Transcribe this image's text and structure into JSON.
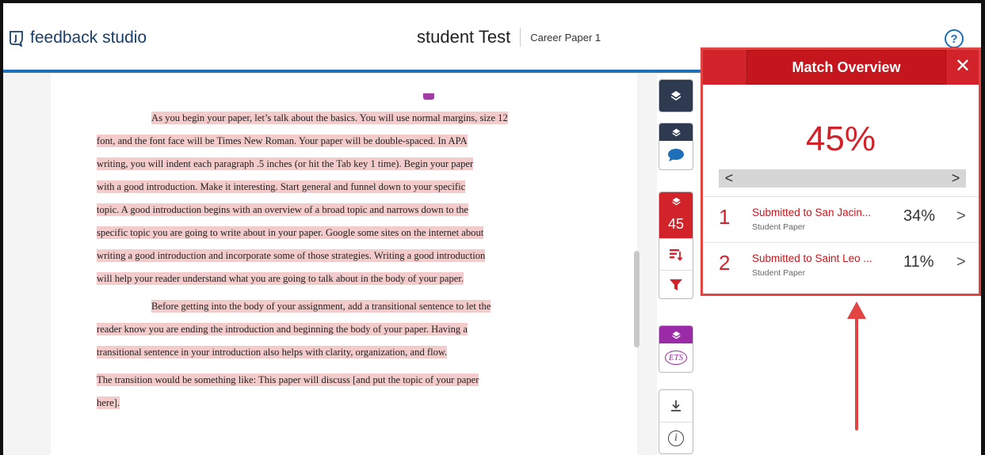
{
  "header": {
    "logo_text": "feedback studio",
    "title": "student Test",
    "subtitle": "Career Paper 1",
    "help_symbol": "?"
  },
  "document": {
    "lines": [
      "As you begin your paper, let’s talk about the basics. You will use normal margins, size 12",
      "font, and the font face will be Times New Roman.  Your paper will be double-spaced. In APA",
      "writing, you will indent each paragraph .5 inches (or hit the Tab key 1 time). Begin your paper",
      "with a good introduction. Make it interesting. Start general and funnel down to your specific",
      "topic. A good introduction begins with an overview of a broad topic and narrows down to the",
      "specific topic you are going to write about in your paper. Google some sites on the internet about",
      "writing a good introduction and incorporate some of those strategies. Writing a good introduction",
      "will help your reader understand what you are going to talk about in the body of your paper.",
      "Before getting into the body of your assignment, add a transitional sentence to let the",
      "reader know you are ending the introduction and beginning the body of your paper. Having a",
      "transitional sentence in your introduction also helps with clarity, organization, and flow.",
      "The transition would be something like: This paper will discuss [and put the topic of your paper",
      "here]."
    ]
  },
  "toolbar": {
    "similarity_score": "45",
    "ets_label": "ETS",
    "info_symbol": "i"
  },
  "match_overview": {
    "title": "Match Overview",
    "overall_pct": "45%",
    "sources": [
      {
        "rank": "1",
        "title": "Submitted to San Jacin...",
        "type": "Student Paper",
        "pct": "34%"
      },
      {
        "rank": "2",
        "title": "Submitted to Saint Leo ...",
        "type": "Student Paper",
        "pct": "11%"
      }
    ]
  },
  "colors": {
    "accent_red": "#d2232a",
    "header_blue": "#1d6fb8",
    "highlight": "#f4cbcb",
    "dark_tool": "#2e3a4f",
    "ets_purple": "#9b2aa6"
  }
}
